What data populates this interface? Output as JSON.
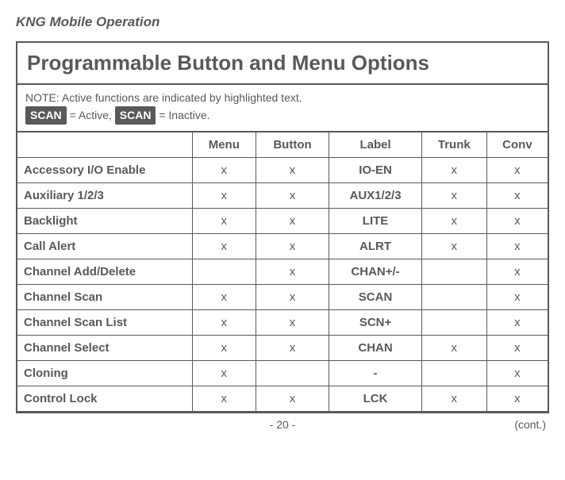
{
  "header": "KNG Mobile Operation",
  "section_title": "Programmable Button and Menu Options",
  "note": {
    "prefix": "NOTE: Active functions are indicated by highlighted text.",
    "active_tag": "SCAN",
    "active_text": " = Active, ",
    "inactive_tag": "SCAN",
    "inactive_text": " = Inactive."
  },
  "columns": [
    "",
    "Menu",
    "Button",
    "Label",
    "Trunk",
    "Conv"
  ],
  "rows": [
    {
      "name": "Accessory I/O Enable",
      "menu": "x",
      "button": "x",
      "label": "IO-EN",
      "trunk": "x",
      "conv": "x"
    },
    {
      "name": "Auxiliary 1/2/3",
      "menu": "x",
      "button": "x",
      "label": "AUX1/2/3",
      "trunk": "x",
      "conv": "x"
    },
    {
      "name": "Backlight",
      "menu": "x",
      "button": "x",
      "label": "LITE",
      "trunk": "x",
      "conv": "x"
    },
    {
      "name": "Call Alert",
      "menu": "x",
      "button": "x",
      "label": "ALRT",
      "trunk": "x",
      "conv": "x"
    },
    {
      "name": "Channel Add/Delete",
      "menu": "",
      "button": "x",
      "label": "CHAN+/-",
      "trunk": "",
      "conv": "x"
    },
    {
      "name": "Channel Scan",
      "menu": "x",
      "button": "x",
      "label": "SCAN",
      "trunk": "",
      "conv": "x"
    },
    {
      "name": "Channel Scan List",
      "menu": "x",
      "button": "x",
      "label": "SCN+",
      "trunk": "",
      "conv": "x"
    },
    {
      "name": "Channel Select",
      "menu": "x",
      "button": "x",
      "label": "CHAN",
      "trunk": "x",
      "conv": "x"
    },
    {
      "name": "Cloning",
      "menu": "x",
      "button": "",
      "label": "-",
      "trunk": "",
      "conv": "x"
    },
    {
      "name": "Control Lock",
      "menu": "x",
      "button": "x",
      "label": "LCK",
      "trunk": "x",
      "conv": "x"
    }
  ],
  "footer": {
    "page": "- 20 -",
    "cont": "(cont.)"
  }
}
